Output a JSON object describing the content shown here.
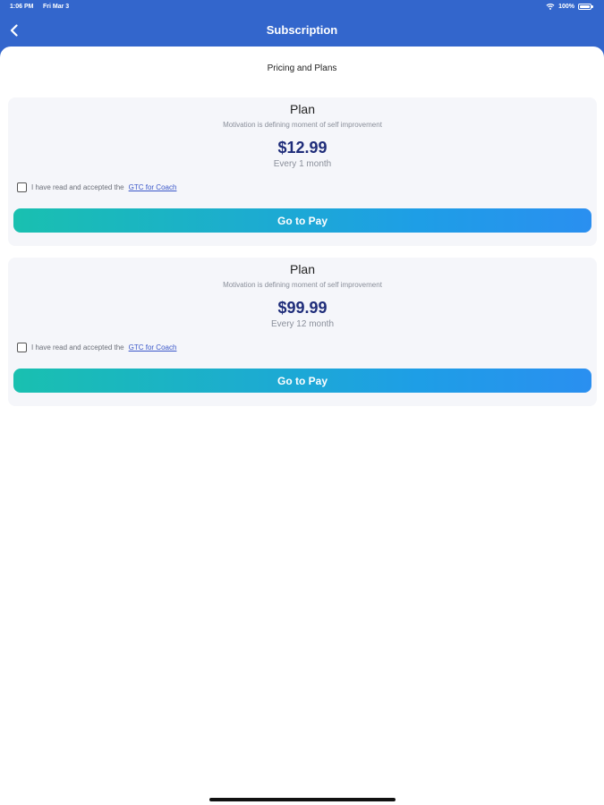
{
  "status_bar": {
    "time": "1:06 PM",
    "date": "Fri Mar 3",
    "battery": "100%",
    "icons": [
      "wifi-icon",
      "battery-icon"
    ]
  },
  "header": {
    "title": "Subscription",
    "back_icon": "chevron-left-icon"
  },
  "section_title": "Pricing and Plans",
  "colors": {
    "header": "#3366cc",
    "price": "#1f2d7a",
    "button_start": "#19c0b0",
    "button_end": "#2a8ff0",
    "card": "#f5f6fa"
  },
  "plans": [
    {
      "name": "Plan",
      "description": "Motivation is defining moment of self improvement",
      "price": "$12.99",
      "period": "Every 1 month",
      "terms_text": "I have read and accepted the",
      "terms_link": "GTC for Coach",
      "checked": false,
      "button_label": "Go to Pay"
    },
    {
      "name": "Plan",
      "description": "Motivation is defining moment of self improvement",
      "price": "$99.99",
      "period": "Every 12 month",
      "terms_text": "I have read and accepted the",
      "terms_link": "GTC for Coach",
      "checked": false,
      "button_label": "Go to Pay"
    }
  ]
}
